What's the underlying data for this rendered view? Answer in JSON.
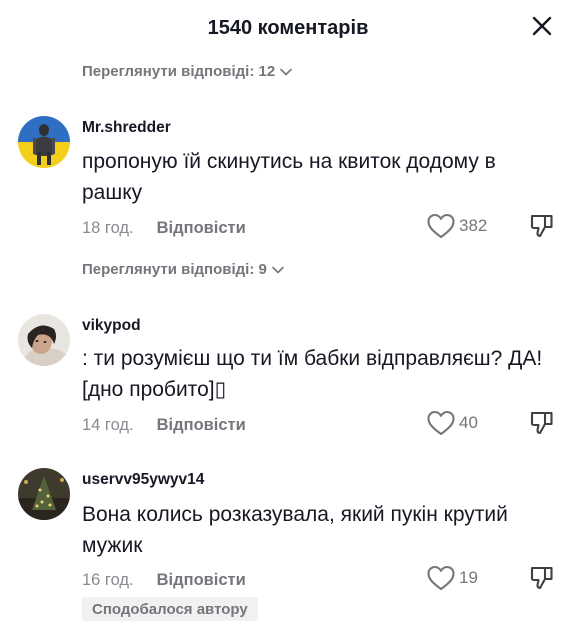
{
  "header": {
    "title": "1540 коментарів"
  },
  "icons": {
    "close": "close-icon",
    "like": "heart-icon",
    "dislike": "thumbs-down-icon",
    "chevron": "chevron-down-icon"
  },
  "colors": {
    "text": "#161823",
    "secondary": "#75767c",
    "badge_bg": "#f1f1f2"
  },
  "view_replies": [
    {
      "label": "Переглянути відповіді: 12"
    },
    {
      "label": "Переглянути відповіді: 9"
    }
  ],
  "comments": [
    {
      "username": "Mr.shredder",
      "text": "пропоную їй скинутись на квиток додому в рашку",
      "time": "18 год.",
      "reply_label": "Відповісти",
      "likes": "382"
    },
    {
      "username": "vikypod",
      "text": ": ти розумієш що ти їм бабки відправляєш? ДА! [дно пробито]▯",
      "time": "14 год.",
      "reply_label": "Відповісти",
      "likes": "40"
    },
    {
      "username": "uservv95ywyv14",
      "text": "Вона колись розказувала, який пукін крутий мужик",
      "time": "16 год.",
      "reply_label": "Відповісти",
      "likes": "19",
      "badge": "Сподобалося автору"
    }
  ]
}
